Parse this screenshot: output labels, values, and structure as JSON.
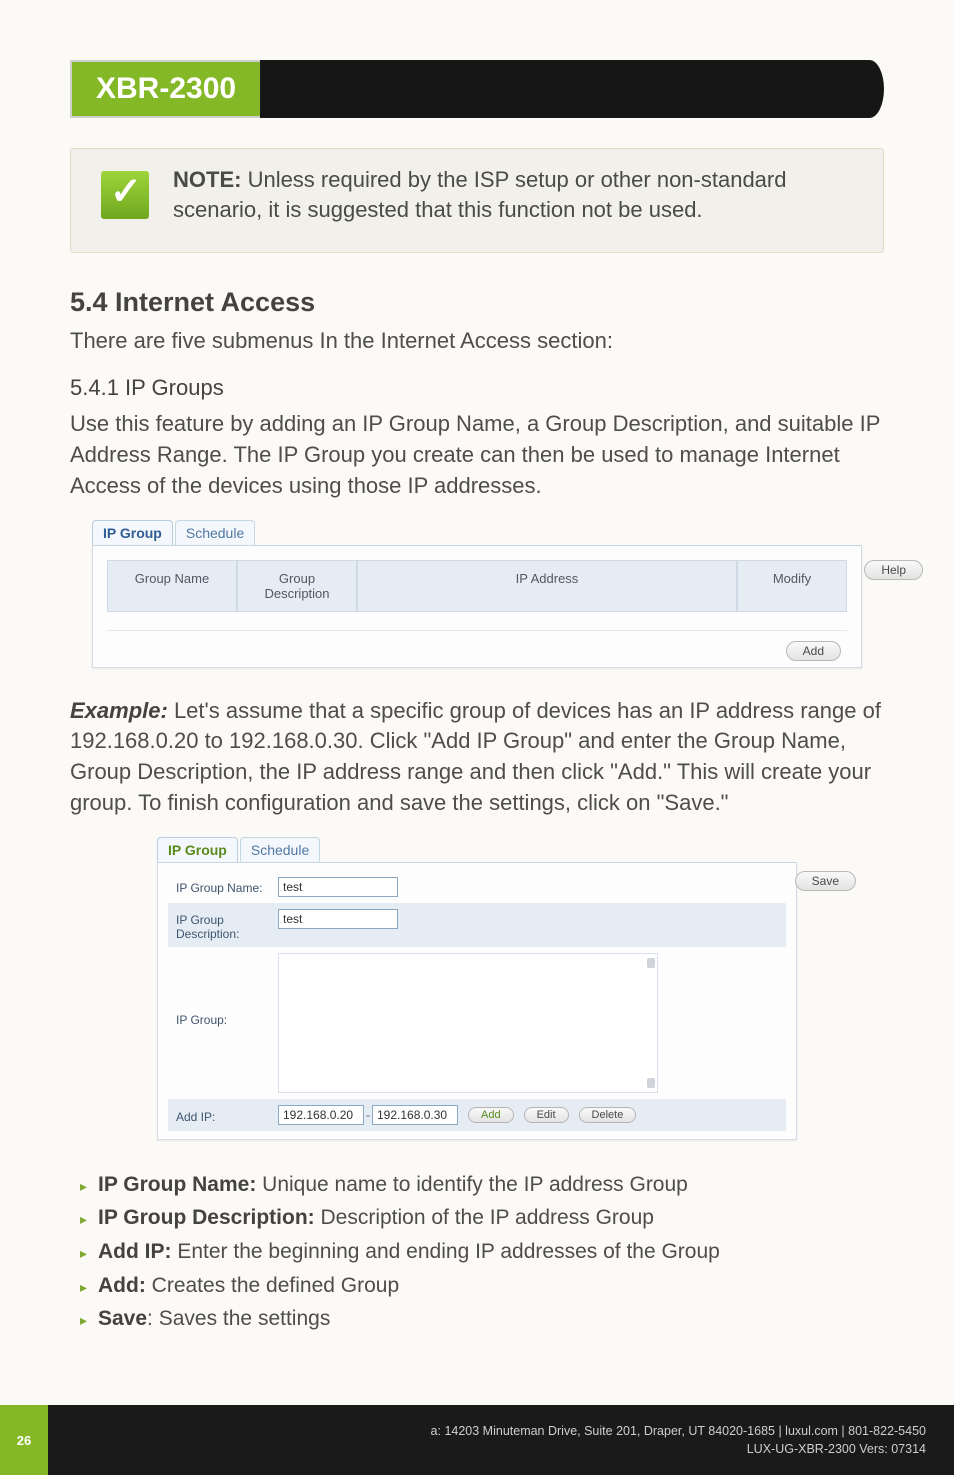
{
  "header": {
    "badge": "XBR-2300"
  },
  "note": {
    "label": "NOTE:",
    "text": " Unless required by the ISP setup or other non-standard scenario, it is suggested that this function not be used."
  },
  "section": {
    "title": "5.4 Internet Access",
    "intro": "There are five submenus In the Internet Access section:",
    "sub_title": "5.4.1 IP Groups",
    "sub_para": "Use this feature by adding an IP Group Name, a Group Description, and suitable IP Address Range. The IP Group you create can then be used to manage Internet Access of the devices using those IP addresses."
  },
  "fig1": {
    "tabs": {
      "active": "IP Group",
      "other": "Schedule"
    },
    "cols": {
      "name": "Group Name",
      "desc": "Group\nDescription",
      "ip": "IP Address",
      "modify": "Modify"
    },
    "add": "Add",
    "help": "Help"
  },
  "example": {
    "label": "Example:",
    "text": " Let's assume that a specific group of devices has an IP address range of 192.168.0.20 to 192.168.0.30. Click \"Add IP Group\" and enter the Group Name, Group Description, the IP address range and then click \"Add.\" This will create your group. To finish configuration and save the settings, click on \"Save.\""
  },
  "fig2": {
    "tabs": {
      "active": "IP Group",
      "other": "Schedule"
    },
    "labels": {
      "name": "IP Group Name:",
      "desc": "IP Group\nDescription:",
      "group": "IP Group:",
      "addip": "Add IP:"
    },
    "values": {
      "name": "test",
      "desc": "test",
      "ip_from": "192.168.0.20",
      "ip_to": "192.168.0.30"
    },
    "buttons": {
      "add": "Add",
      "edit": "Edit",
      "delete": "Delete",
      "save": "Save"
    }
  },
  "bullets": [
    {
      "term": "IP Group Name:",
      "def": " Unique name to identify the IP address Group"
    },
    {
      "term": "IP Group Description:",
      "def": " Description of the IP address Group"
    },
    {
      "term": "Add IP:",
      "def": " Enter the beginning and ending IP addresses of the Group"
    },
    {
      "term": "Add:",
      "def": " Creates the defined Group"
    },
    {
      "term": "Save",
      "def": ": Saves the settings"
    }
  ],
  "footer": {
    "page": "26",
    "line1": "a: 14203 Minuteman Drive, Suite 201, Draper, UT 84020-1685 | luxul.com | 801-822-5450",
    "line2": "LUX-UG-XBR-2300  Vers: 07314"
  }
}
